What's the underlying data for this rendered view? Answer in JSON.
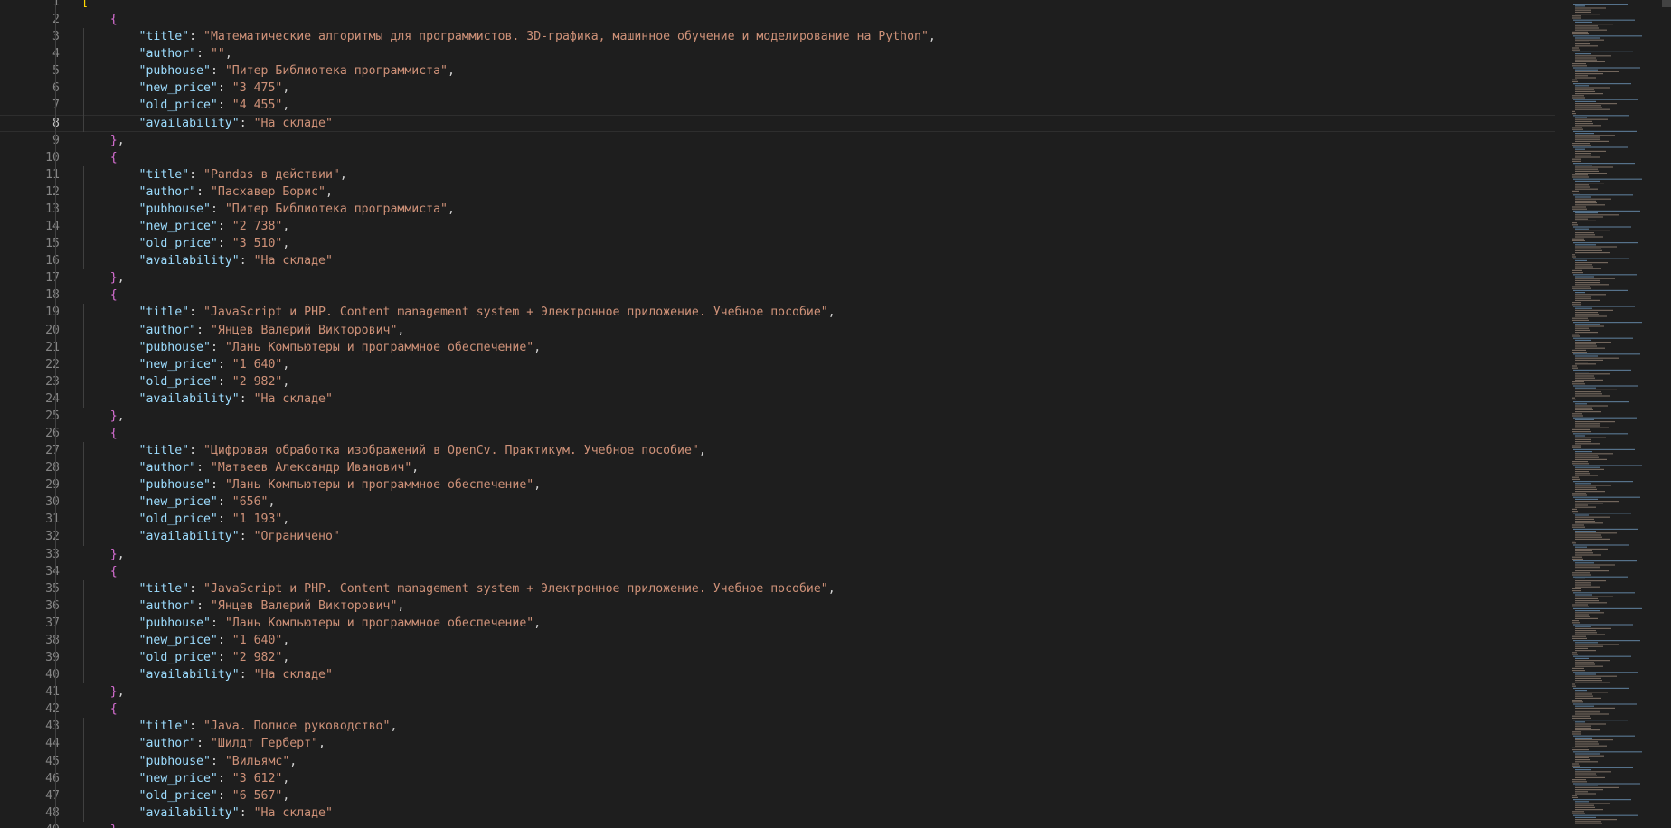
{
  "editor": {
    "language": "json",
    "current_line": 8,
    "lines": [
      "[",
      "    {",
      "        \"title\": \"Математические алгоритмы для программистов. 3D-графика, машинное обучение и моделирование на Python\",",
      "        \"author\": \"\",",
      "        \"pubhouse\": \"Питер Библиотека программиста\",",
      "        \"new_price\": \"3 475\",",
      "        \"old_price\": \"4 455\",",
      "        \"availability\": \"На складе\"",
      "    },",
      "    {",
      "        \"title\": \"Pandas в действии\",",
      "        \"author\": \"Пасхавер Борис\",",
      "        \"pubhouse\": \"Питер Библиотека программиста\",",
      "        \"new_price\": \"2 738\",",
      "        \"old_price\": \"3 510\",",
      "        \"availability\": \"На складе\"",
      "    },",
      "    {",
      "        \"title\": \"JavaScript и PHP. Content management system + Электронное приложение. Учебное пособие\",",
      "        \"author\": \"Янцев Валерий Викторович\",",
      "        \"pubhouse\": \"Лань Компьютеры и программное обеспечение\",",
      "        \"new_price\": \"1 640\",",
      "        \"old_price\": \"2 982\",",
      "        \"availability\": \"На складе\"",
      "    },",
      "    {",
      "        \"title\": \"Цифровая обработка изображений в OpenCv. Практикум. Учебное пособие\",",
      "        \"author\": \"Матвеев Александр Иванович\",",
      "        \"pubhouse\": \"Лань Компьютеры и программное обеспечение\",",
      "        \"new_price\": \"656\",",
      "        \"old_price\": \"1 193\",",
      "        \"availability\": \"Ограничено\"",
      "    },",
      "    {",
      "        \"title\": \"JavaScript и PHP. Content management system + Электронное приложение. Учебное пособие\",",
      "        \"author\": \"Янцев Валерий Викторович\",",
      "        \"pubhouse\": \"Лань Компьютеры и программное обеспечение\",",
      "        \"new_price\": \"1 640\",",
      "        \"old_price\": \"2 982\",",
      "        \"availability\": \"На складе\"",
      "    },",
      "    {",
      "        \"title\": \"Java. Полное руководство\",",
      "        \"author\": \"Шилдт Герберт\",",
      "        \"pubhouse\": \"Вильямс\",",
      "        \"new_price\": \"3 612\",",
      "        \"old_price\": \"6 567\",",
      "        \"availability\": \"На складе\"",
      "    },"
    ]
  },
  "colors": {
    "background": "#1e1e1e",
    "line_number": "#858585",
    "key": "#9cdcfe",
    "string": "#ce9178",
    "punctuation": "#d4d4d4",
    "bracket_outer": "#ffd700",
    "bracket_inner": "#da70d6"
  }
}
